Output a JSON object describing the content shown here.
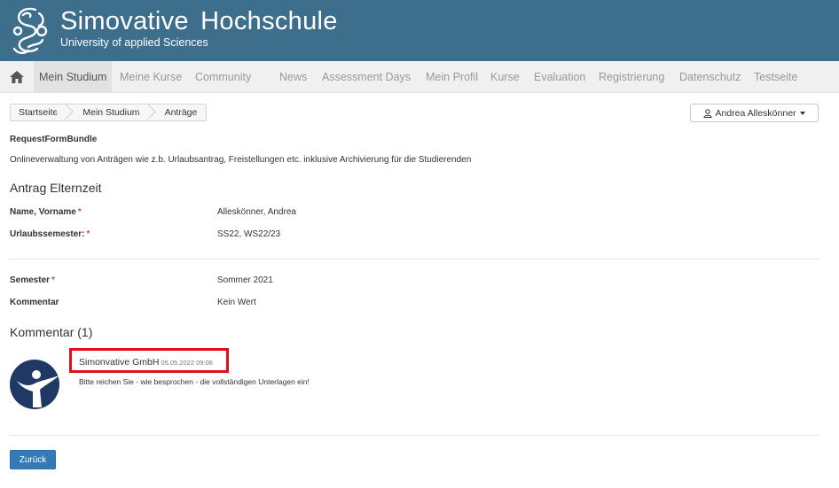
{
  "header": {
    "title": "Simovative Hochschule",
    "subtitle": "University of applied Sciences",
    "logo_icon": "seal-logo-icon",
    "color": "#3d6e8c"
  },
  "nav": {
    "home_icon": "home-icon",
    "items": [
      "Mein Studium",
      "Meine Kurse",
      "Community",
      "News",
      "Assessment Days",
      "Mein Profil",
      "Kurse",
      "Evaluation",
      "Registrierung",
      "Datenschutz",
      "Testseite"
    ],
    "active": "Mein Studium"
  },
  "breadcrumb": [
    "Startseite",
    "Mein Studium",
    "Anträge"
  ],
  "user_menu": {
    "label": "Andrea Alleskönner",
    "icon": "user-icon"
  },
  "bundle": {
    "title": "RequestFormBundle",
    "description": "Onlineverwaltung von Anträgen wie z.b. Urlaubsantrag, Freistellungen etc. inklusive Archivierung für die Studierenden"
  },
  "form": {
    "title": "Antrag Elternzeit",
    "fields": [
      {
        "label": "Name, Vorname",
        "required": "*",
        "value": "Alleskönner, Andrea"
      },
      {
        "label": "Urlaubssemester:",
        "required": "*",
        "value": "SS22, WS22/23"
      },
      {
        "label": "Semester",
        "required": "*",
        "value": "Sommer 2021"
      },
      {
        "label": "Kommentar",
        "required": "",
        "value": "Kein Wert"
      }
    ]
  },
  "comments": {
    "title": "Kommentar (1)",
    "items": [
      {
        "author": "Simonvative GmbH",
        "date": "05.05.2022 09:06",
        "text": "Bitte reichen Sie - wie besprochen - die vollständigen Unterlagen ein!",
        "avatar_icon": "person-logo-icon",
        "highlight_color": "#e0101b"
      }
    ]
  },
  "actions": {
    "back_label": "Zurück",
    "accent": "#337ab7"
  }
}
